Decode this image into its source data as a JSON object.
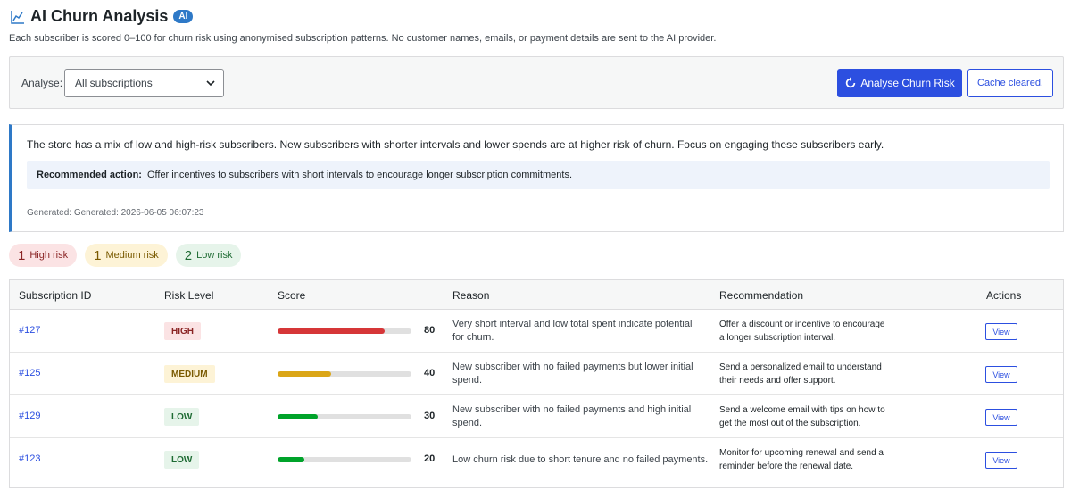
{
  "header": {
    "title": "AI Churn Analysis",
    "badge": "AI",
    "subtitle": "Each subscriber is scored 0–100 for churn risk using anonymised subscription patterns. No customer names, emails, or payment details are sent to the AI provider."
  },
  "toolbar": {
    "analyse_label": "Analyse:",
    "select_value": "All subscriptions",
    "analyse_button": "Analyse Churn Risk",
    "cache_button": "Cache cleared."
  },
  "summary": {
    "text": "The store has a mix of low and high-risk subscribers. New subscribers with shorter intervals and lower spends are at higher risk of churn. Focus on engaging these subscribers early.",
    "recommended_label": "Recommended action:",
    "recommended_text": "Offer incentives to subscribers with short intervals to encourage longer subscription commitments.",
    "generated": "Generated: Generated: 2026-06-05 06:07:23"
  },
  "pills": [
    {
      "count": "1",
      "label": "High risk"
    },
    {
      "count": "1",
      "label": "Medium risk"
    },
    {
      "count": "2",
      "label": "Low risk"
    }
  ],
  "table": {
    "headers": [
      "Subscription ID",
      "Risk Level",
      "Score",
      "Reason",
      "Recommendation",
      "Actions"
    ],
    "rows": [
      {
        "id": "#127",
        "risk": "HIGH",
        "score": "80",
        "score_value": 80,
        "reason": "Very short interval and low total spent indicate potential for churn.",
        "recommendation": "Offer a discount or incentive to encourage a longer subscription interval.",
        "action": "View"
      },
      {
        "id": "#125",
        "risk": "MEDIUM",
        "score": "40",
        "score_value": 40,
        "reason": "New subscriber with no failed payments but lower initial spend.",
        "recommendation": "Send a personalized email to understand their needs and offer support.",
        "action": "View"
      },
      {
        "id": "#129",
        "risk": "LOW",
        "score": "30",
        "score_value": 30,
        "reason": "New subscriber with no failed payments and high initial spend.",
        "recommendation": "Send a welcome email with tips on how to get the most out of the subscription.",
        "action": "View"
      },
      {
        "id": "#123",
        "risk": "LOW",
        "score": "20",
        "score_value": 20,
        "reason": "Low churn risk due to short tenure and no failed payments.",
        "recommendation": "Monitor for upcoming renewal and send a reminder before the renewal date.",
        "action": "View"
      }
    ]
  },
  "colors": {
    "primary": "#2c4fe0",
    "high": "#d63638",
    "medium": "#dba617",
    "low": "#00a32a"
  },
  "icons": {
    "header": "chart-line-icon",
    "analyse_button": "refresh-icon",
    "select": "chevron-down-icon"
  }
}
